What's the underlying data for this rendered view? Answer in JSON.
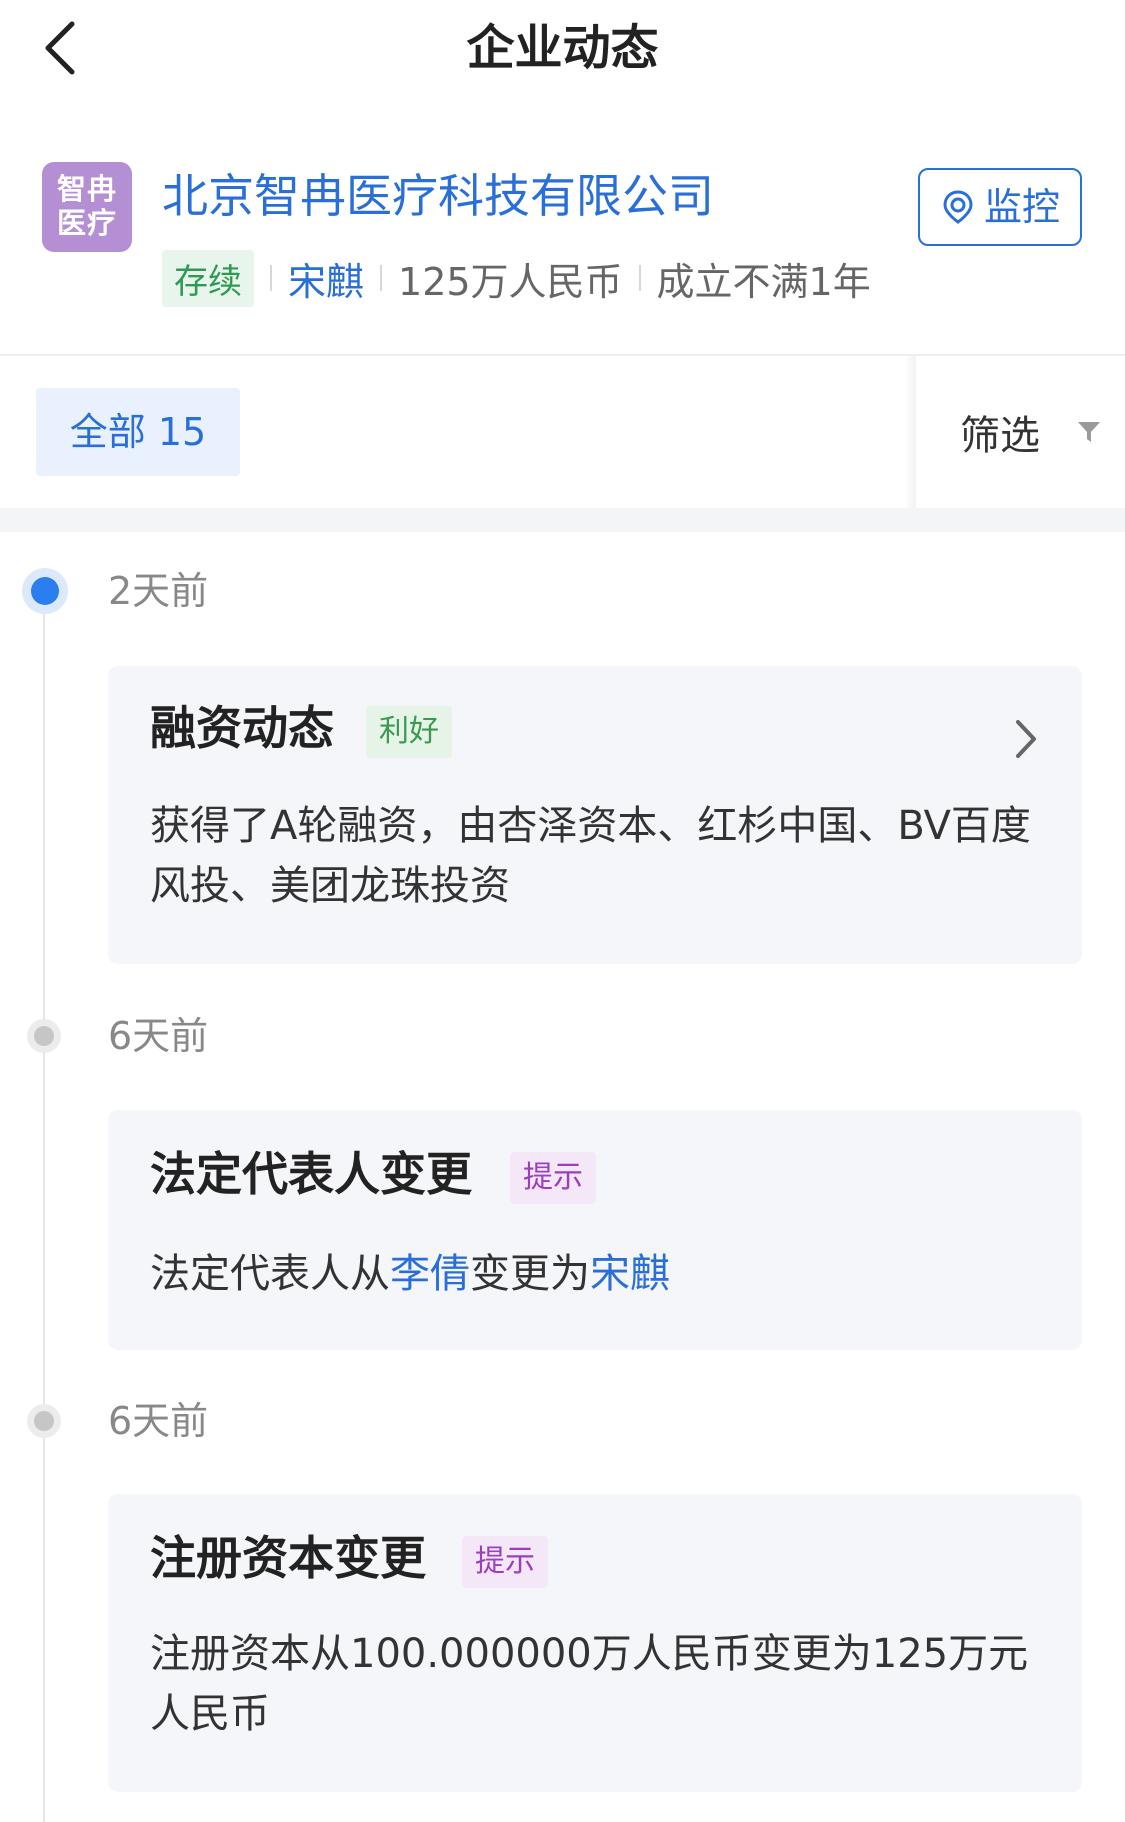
{
  "nav": {
    "title": "企业动态"
  },
  "company": {
    "logo_line1": "智冉",
    "logo_line2": "医疗",
    "name": "北京智冉医疗科技有限公司",
    "monitor_label": "监控",
    "status": "存续",
    "legal_person": "宋麒",
    "capital": "125万人民币",
    "founded": "成立不满1年"
  },
  "tabs": {
    "all_label": "全部 15",
    "filter_label": "筛选"
  },
  "events": [
    {
      "time": "2天前",
      "title": "融资动态",
      "tag": "利好",
      "text": "获得了A轮融资，由杏泽资本、红杉中国、BV百度风投、美团龙珠投资"
    },
    {
      "time": "6天前",
      "title": "法定代表人变更",
      "tag": "提示",
      "text_prefix": "法定代表人从",
      "old_person": "李倩",
      "text_middle": "变更为",
      "new_person": "宋麒"
    },
    {
      "time": "6天前",
      "title": "注册资本变更",
      "tag": "提示",
      "text": "注册资本从100.000000万人民币变更为125万元人民币"
    }
  ],
  "colors": {
    "accent_blue": "#2a6fd8",
    "good_green": "#3a9a4f",
    "hint_purple": "#9b3fc2",
    "logo_purple": "#b48fd4"
  }
}
